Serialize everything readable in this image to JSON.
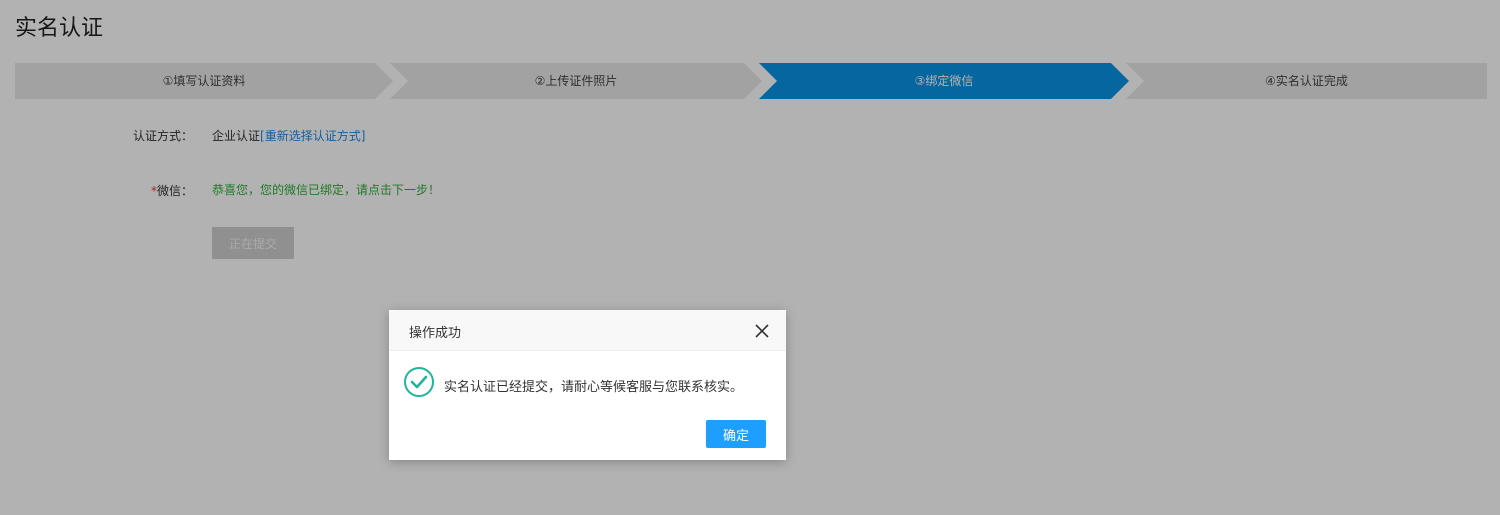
{
  "page": {
    "title": "实名认证"
  },
  "steps": [
    {
      "label": "①填写认证资料",
      "active": false
    },
    {
      "label": "②上传证件照片",
      "active": false
    },
    {
      "label": "③绑定微信",
      "active": true
    },
    {
      "label": "④实名认证完成",
      "active": false
    }
  ],
  "form": {
    "method_label": "认证方式：",
    "method_value": "企业认证",
    "method_link": "[重新选择认证方式]",
    "wechat_required_mark": "*",
    "wechat_label": "微信：",
    "wechat_status": "恭喜您，您的微信已绑定，请点击下一步！",
    "submit_label": "正在提交"
  },
  "modal": {
    "title": "操作成功",
    "icon": "check-circle-icon",
    "message": "实名认证已经提交，请耐心等候客服与您联系核实。",
    "confirm_label": "确定"
  },
  "colors": {
    "step_active": "#0a92e6",
    "step_inactive": "#e8e8e8",
    "success_text": "#2fae3a",
    "link": "#1e88e5",
    "confirm_button": "#1e9fff",
    "check_icon": "#20b59a"
  }
}
